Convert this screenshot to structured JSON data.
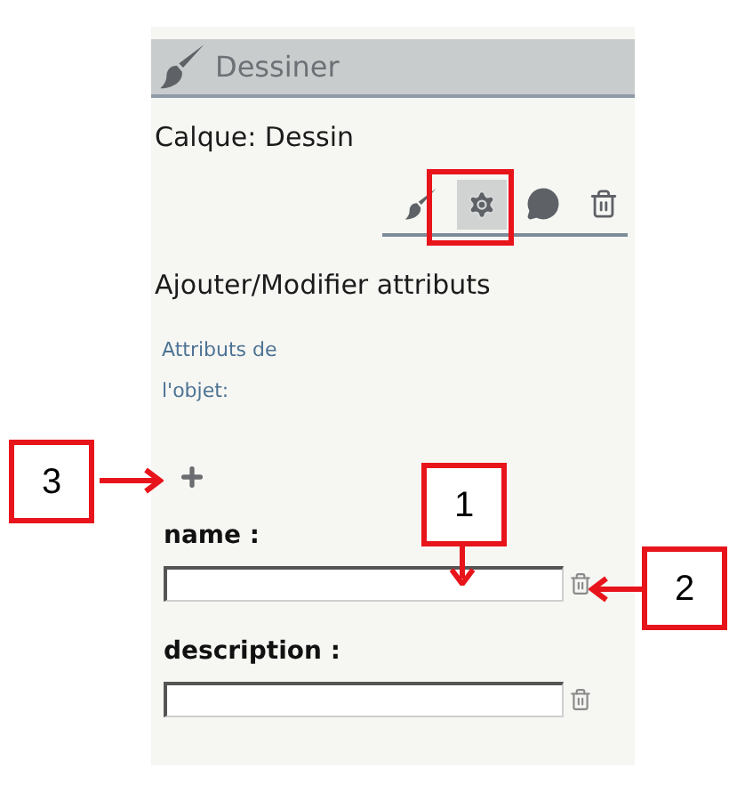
{
  "panel": {
    "title": "Dessiner",
    "layer": "Calque: Dessin",
    "tools": [
      {
        "kind": "brush",
        "selected": false
      },
      {
        "kind": "settings",
        "selected": true
      },
      {
        "kind": "comment",
        "selected": false
      },
      {
        "kind": "delete",
        "selected": false
      }
    ],
    "section_title": "Ajouter/Modifier attributs",
    "attributes_label": "Attributs de l'objet:",
    "fields": [
      {
        "label": "name :"
      },
      {
        "label": "description :"
      }
    ]
  },
  "callouts": [
    {
      "number": "1"
    },
    {
      "number": "2"
    },
    {
      "number": "3"
    }
  ]
}
